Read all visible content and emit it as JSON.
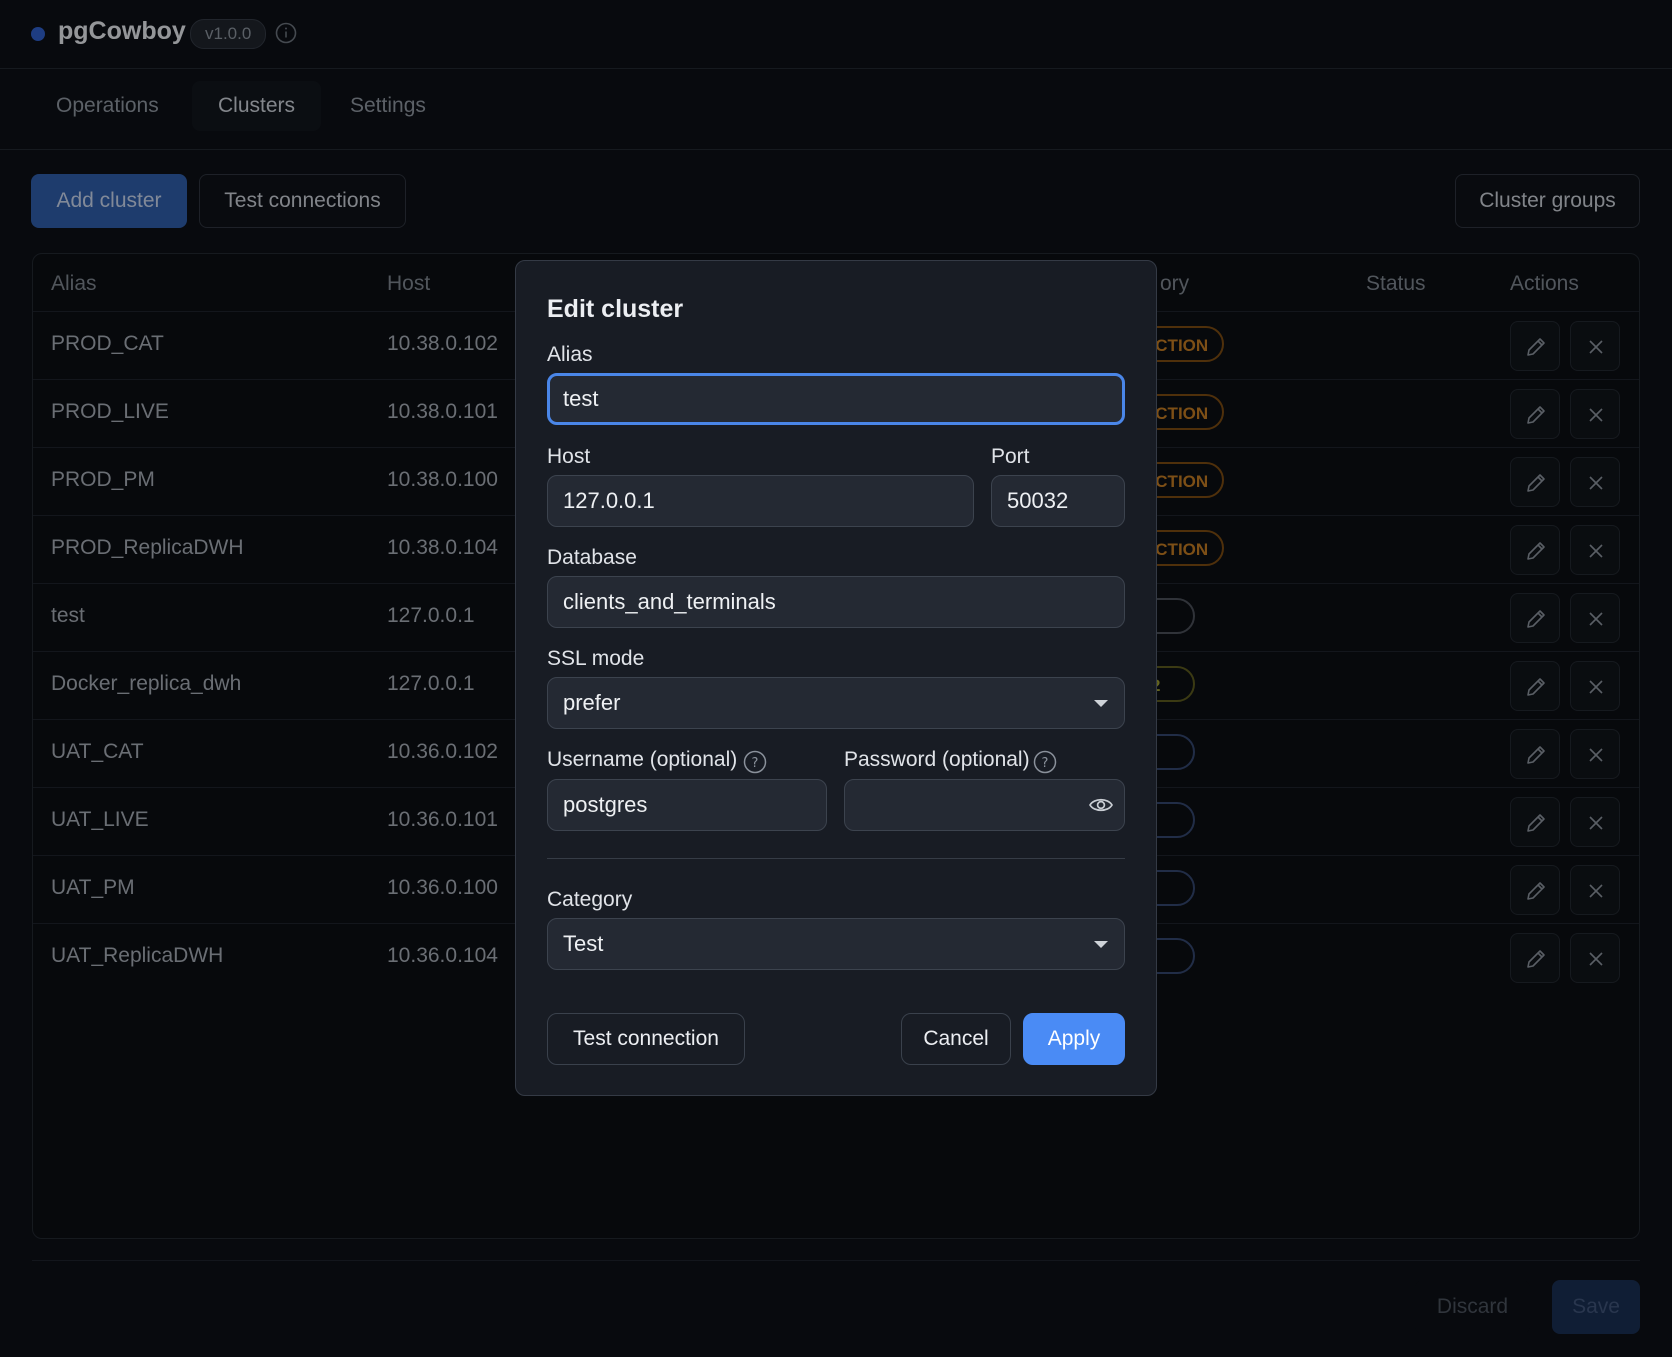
{
  "app": {
    "name": "pgCowboy",
    "version": "v1.0.0"
  },
  "tabs": [
    {
      "label": "Operations"
    },
    {
      "label": "Clusters"
    },
    {
      "label": "Settings"
    }
  ],
  "toolbar": {
    "add_cluster": "Add cluster",
    "test_connections": "Test connections",
    "cluster_groups": "Cluster groups"
  },
  "table": {
    "headers": {
      "alias": "Alias",
      "host": "Host",
      "category": "ory",
      "status": "Status",
      "actions": "Actions"
    },
    "rows": [
      {
        "alias": "PROD_CAT",
        "host": "10.38.0.102",
        "category": "UCTION"
      },
      {
        "alias": "PROD_LIVE",
        "host": "10.38.0.101",
        "category": "UCTION"
      },
      {
        "alias": "PROD_PM",
        "host": "10.38.0.100",
        "category": "UCTION"
      },
      {
        "alias": "PROD_ReplicaDWH",
        "host": "10.38.0.104",
        "category": "UCTION"
      },
      {
        "alias": "test",
        "host": "127.0.0.1",
        "category": ""
      },
      {
        "alias": "Docker_replica_dwh",
        "host": "127.0.0.1",
        "category": "2"
      },
      {
        "alias": "UAT_CAT",
        "host": "10.36.0.102",
        "category": ""
      },
      {
        "alias": "UAT_LIVE",
        "host": "10.36.0.101",
        "category": ""
      },
      {
        "alias": "UAT_PM",
        "host": "10.36.0.100",
        "category": ""
      },
      {
        "alias": "UAT_ReplicaDWH",
        "host": "10.36.0.104",
        "category": ""
      }
    ]
  },
  "footer": {
    "discard": "Discard",
    "save": "Save"
  },
  "modal": {
    "title": "Edit cluster",
    "alias_label": "Alias",
    "alias_value": "test",
    "host_label": "Host",
    "host_value": "127.0.0.1",
    "port_label": "Port",
    "port_value": "50032",
    "database_label": "Database",
    "database_value": "clients_and_terminals",
    "ssl_label": "SSL mode",
    "ssl_value": "prefer",
    "username_label": "Username (optional)",
    "username_value": "postgres",
    "password_label": "Password (optional)",
    "password_value": "",
    "category_label": "Category",
    "category_value": "Test",
    "test_connection": "Test connection",
    "cancel": "Cancel",
    "apply": "Apply"
  },
  "colors": {
    "accent": "#4a8bf5",
    "production_badge": "#c07a22",
    "background": "#0d1016",
    "modal_bg": "#181c24"
  },
  "icons": [
    "status-dot",
    "info-icon",
    "pencil-icon",
    "close-icon",
    "help-icon",
    "eye-icon",
    "chevron-down-icon"
  ]
}
